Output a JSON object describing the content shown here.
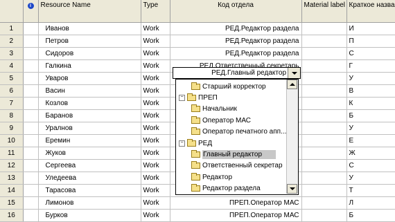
{
  "columns": {
    "info_icon": "i",
    "resource_name": "Resource Name",
    "type": "Type",
    "dept": "Код отдела",
    "material_label": "Material label",
    "short_name": "Краткое название"
  },
  "rows": [
    {
      "num": "1",
      "name": "Иванов",
      "type": "Work",
      "dept": "РЕД.Редактор раздела",
      "short": "И"
    },
    {
      "num": "2",
      "name": "Петров",
      "type": "Work",
      "dept": "РЕД.Редактор раздела",
      "short": "П"
    },
    {
      "num": "3",
      "name": "Сидоров",
      "type": "Work",
      "dept": "РЕД.Редактор раздела",
      "short": "С"
    },
    {
      "num": "4",
      "name": "Галкина",
      "type": "Work",
      "dept": "РЕД.Ответственный секретарь",
      "short": "Г"
    },
    {
      "num": "5",
      "name": "Уваров",
      "type": "Work",
      "dept": "",
      "short": "У"
    },
    {
      "num": "6",
      "name": "Васин",
      "type": "Work",
      "dept": "",
      "short": "В"
    },
    {
      "num": "7",
      "name": "Козлов",
      "type": "Work",
      "dept": "",
      "short": "К"
    },
    {
      "num": "8",
      "name": "Баранов",
      "type": "Work",
      "dept": "",
      "short": "Б"
    },
    {
      "num": "9",
      "name": "Уралнов",
      "type": "Work",
      "dept": "",
      "short": "У"
    },
    {
      "num": "10",
      "name": "Еремин",
      "type": "Work",
      "dept": "",
      "short": "Е"
    },
    {
      "num": "11",
      "name": "Жуков",
      "type": "Work",
      "dept": "",
      "short": "Ж"
    },
    {
      "num": "12",
      "name": "Сергеева",
      "type": "Work",
      "dept": "",
      "short": "С"
    },
    {
      "num": "13",
      "name": "Уледеева",
      "type": "Work",
      "dept": "",
      "short": "У"
    },
    {
      "num": "14",
      "name": "Тарасова",
      "type": "Work",
      "dept": "",
      "short": "Т"
    },
    {
      "num": "15",
      "name": "Лимонов",
      "type": "Work",
      "dept": "ПРЕП.Оператор МАС",
      "short": "Л"
    },
    {
      "num": "16",
      "name": "Бурков",
      "type": "Work",
      "dept": "ПРЕП.Оператор МАС",
      "short": "Б"
    }
  ],
  "combo": {
    "value": "РЕД.Главный редактор"
  },
  "tree": [
    {
      "label": "Старший корректор",
      "selected": false
    },
    {
      "label": "ПРЕП",
      "selected": false
    },
    {
      "label": "Начальник",
      "selected": false
    },
    {
      "label": "Оператор МАС",
      "selected": false
    },
    {
      "label": "Оператор печатного апп...",
      "selected": false
    },
    {
      "label": "РЕД",
      "selected": false
    },
    {
      "label": "Главный редактор",
      "selected": true
    },
    {
      "label": "Ответственный секретар",
      "selected": false
    },
    {
      "label": "Редактор",
      "selected": false
    },
    {
      "label": "Редактор раздела",
      "selected": false
    }
  ],
  "colors": {
    "header_bg": "#ece9d8",
    "grid_line": "#c0c0c0",
    "info_icon": "#1e48c8",
    "folder": "#f5e08a",
    "selection": "#c8c8c8"
  }
}
